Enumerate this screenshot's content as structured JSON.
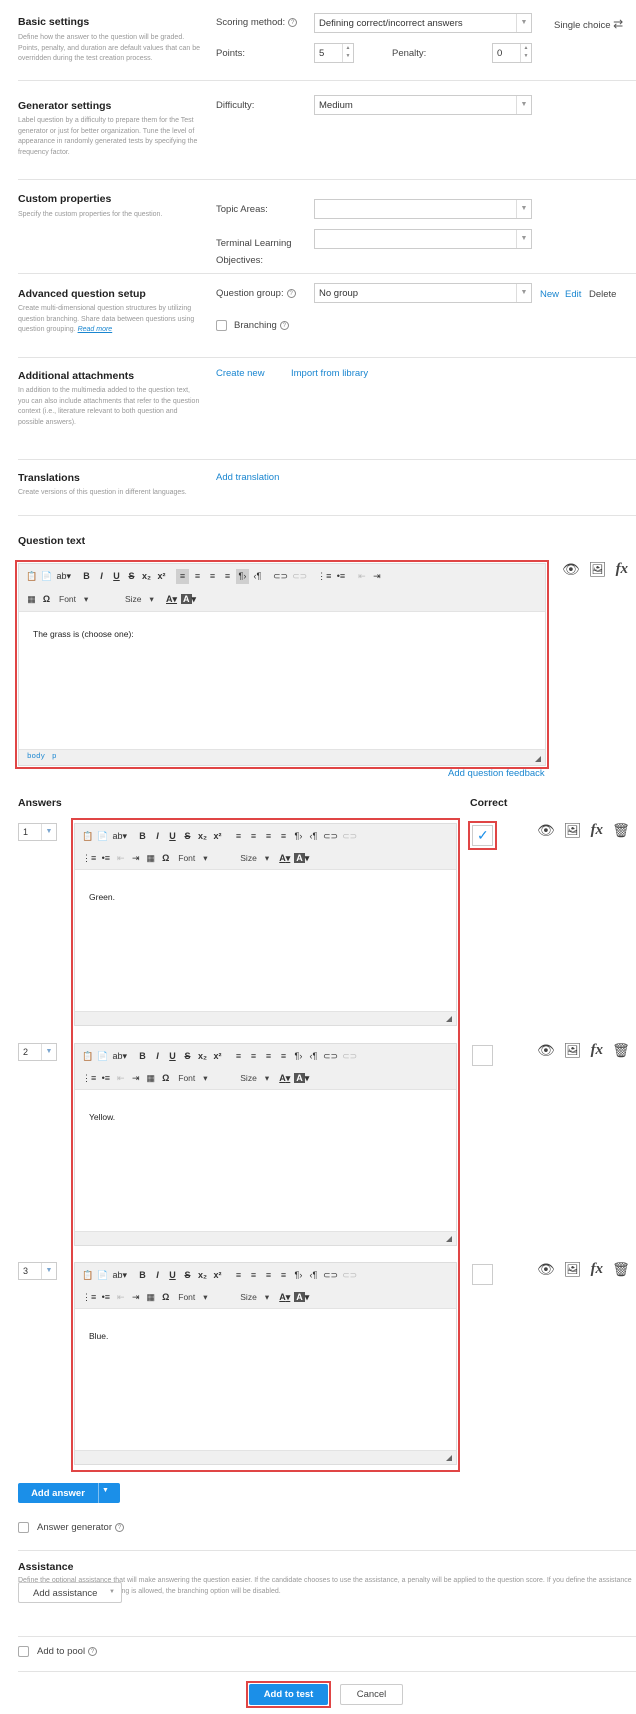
{
  "header": {
    "question_type": "Single choice",
    "swap_icon": "swap-arrows-icon"
  },
  "basic_settings": {
    "title": "Basic settings",
    "description": "Define how the answer to the question will be graded. Points, penalty, and duration are default values that can be overridden during the test creation process.",
    "scoring_label": "Scoring method:",
    "scoring_value": "Defining correct/incorrect answers",
    "points_label": "Points:",
    "points_value": "5",
    "penalty_label": "Penalty:",
    "penalty_value": "0"
  },
  "generator_settings": {
    "title": "Generator settings",
    "description": "Label question by a difficulty to prepare them for the Test generator or just for better organization. Tune the level of appearance in randomly generated tests by specifying the frequency factor.",
    "difficulty_label": "Difficulty:",
    "difficulty_value": "Medium"
  },
  "custom_properties": {
    "title": "Custom properties",
    "description": "Specify the custom properties for the question.",
    "topic_label": "Topic Areas:",
    "topic_value": "",
    "tlo_label": "Terminal Learning Objectives:",
    "tlo_value": ""
  },
  "advanced": {
    "title": "Advanced question setup",
    "description": "Create multi-dimensional question structures by utilizing question branching. Share data between questions using question grouping.",
    "read_more": "Read more",
    "group_label": "Question group:",
    "group_value": "No group",
    "new": "New",
    "edit": "Edit",
    "delete": "Delete",
    "branching": "Branching"
  },
  "attachments": {
    "title": "Additional attachments",
    "description": "In addition to the multimedia added to the question text, you can also include attachments that refer to the question context (i.e., literature relevant to both question and possible answers).",
    "create_new": "Create new",
    "import": "Import from library"
  },
  "translations": {
    "title": "Translations",
    "description": "Create versions of this question in different languages.",
    "add": "Add translation"
  },
  "question_text": {
    "title": "Question text",
    "content": "The grass is (choose one):",
    "path_body": "body",
    "path_p": "p",
    "add_feedback": "Add question feedback"
  },
  "toolbar": {
    "bold": "B",
    "italic": "I",
    "underline": "U",
    "strike": "S",
    "sub": "x₂",
    "sup": "x²",
    "font": "Font",
    "size": "Size",
    "text_color": "A",
    "bg_color": "A",
    "omega": "Ω"
  },
  "answers": {
    "title": "Answers",
    "correct_title": "Correct",
    "items": [
      {
        "number": "1",
        "text": "Green.",
        "correct": true
      },
      {
        "number": "2",
        "text": "Yellow.",
        "correct": false
      },
      {
        "number": "3",
        "text": "Blue.",
        "correct": false
      }
    ],
    "add_answer": "Add answer",
    "answer_generator": "Answer generator"
  },
  "assistance": {
    "title": "Assistance",
    "description": "Define the optional assistance that will make answering the question easier. If the candidate chooses to use the assistance, a penalty will be applied to the question score. If you define the assistance to the question where the branching is allowed, the branching option will be disabled.",
    "add": "Add assistance"
  },
  "pool": {
    "label": "Add to pool"
  },
  "footer": {
    "add_to_test": "Add to test",
    "cancel": "Cancel"
  },
  "colors": {
    "accent": "#1b8fe8",
    "highlight": "#e04545"
  }
}
